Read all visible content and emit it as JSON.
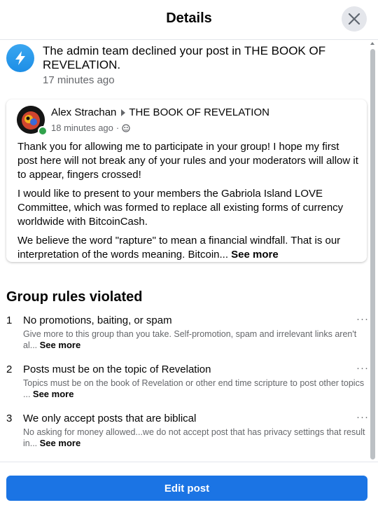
{
  "header": {
    "title": "Details",
    "close_icon": "close-icon"
  },
  "notification": {
    "icon": "lightning-bolt-icon",
    "text": "The admin team declined your post in THE BOOK OF REVELATION.",
    "time": "17 minutes ago"
  },
  "post": {
    "author": "Alex Strachan",
    "group": "THE BOOK OF REVELATION",
    "time": "18 minutes ago",
    "separator": "·",
    "privacy_icon": "group-privacy-icon",
    "paragraphs": [
      "Thank you for allowing me to participate in your group!  I hope my first post here will not break any of your rules and your moderators will allow it to appear, fingers crossed!",
      "I would like to present to your members the Gabriola Island LOVE Committee, which was formed to replace all existing forms of currency worldwide with BitcoinCash.",
      "We believe the word \"rapture\" to mean a financial windfall.  That is our interpretation of the words meaning.   Bitcoin..."
    ],
    "see_more": "See more"
  },
  "rules": {
    "heading": "Group rules violated",
    "items": [
      {
        "number": "1",
        "title": "No promotions, baiting, or spam",
        "description": "Give more to this group than you take. Self-promotion, spam and irrelevant links aren't al...",
        "see_more": "See more"
      },
      {
        "number": "2",
        "title": "Posts must be on the topic of Revelation",
        "description": "Topics must be on the book of Revelation or other end time scripture to post other topics ...",
        "see_more": "See more"
      },
      {
        "number": "3",
        "title": "We only accept posts that are biblical",
        "description": "No asking for money allowed...we do not accept post that has privacy settings that result in...",
        "see_more": "See more"
      }
    ],
    "more_icon": "···"
  },
  "footer": {
    "edit_button": "Edit post"
  },
  "colors": {
    "primary": "#1b74e4",
    "secondary_text": "#65676b",
    "online": "#31a24c"
  }
}
